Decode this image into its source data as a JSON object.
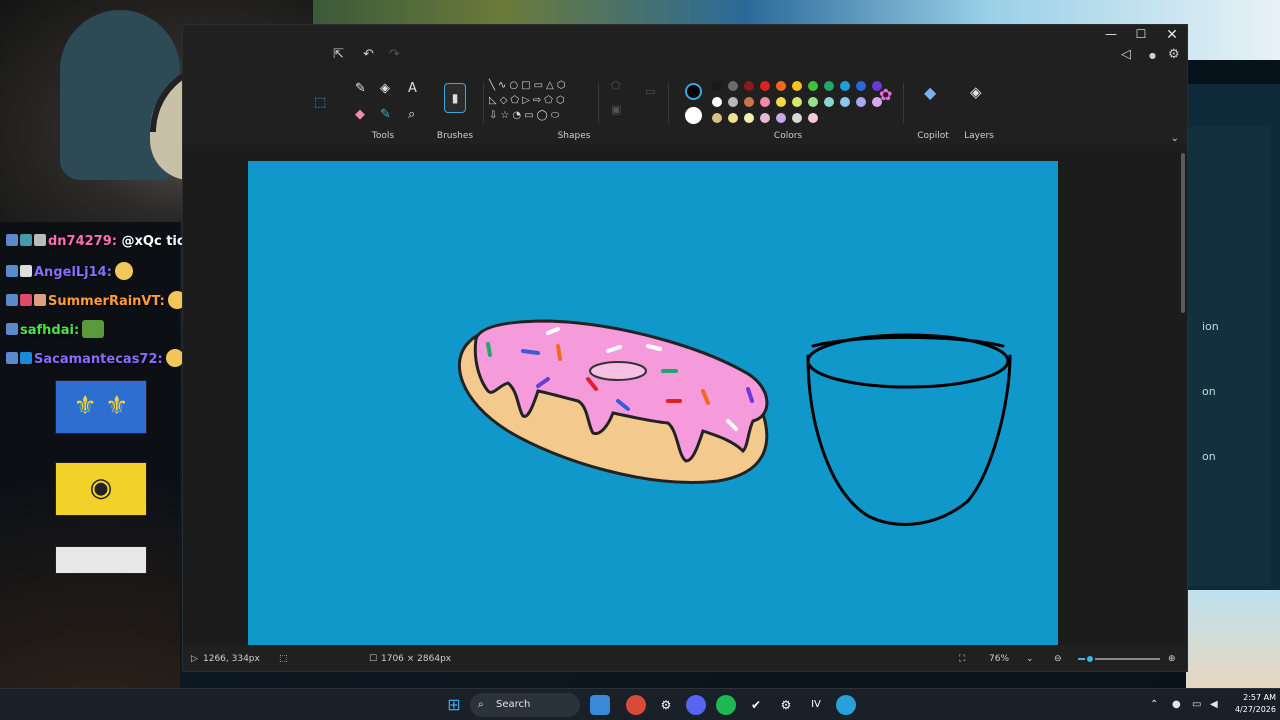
{
  "chat": {
    "messages": [
      {
        "user": "dn74279:",
        "text": "@xQc tickle him pls",
        "color": "#ff6fb5"
      },
      {
        "user": "AngelLj14:",
        "text": "",
        "color": "#8a6cff"
      },
      {
        "user": "SummerRainVT:",
        "text": "",
        "color": "#ff9b3a"
      },
      {
        "user": "safhdai:",
        "text": "",
        "color": "#4ce04c"
      },
      {
        "user": "Sacamantecas72:",
        "text": "",
        "color": "#8a6cff"
      }
    ]
  },
  "paint": {
    "ribbon": {
      "tools_label": "Tools",
      "brushes_label": "Brushes",
      "shapes_label": "Shapes",
      "colors_label": "Colors",
      "copilot_label": "Copilot",
      "layers_label": "Layers"
    },
    "colors": {
      "row1": [
        "#1a1a1a",
        "#6b6b6b",
        "#8b1a1a",
        "#e02020",
        "#f36a1a",
        "#f7c21a",
        "#3cc43c",
        "#1fa86a",
        "#1aa0d8",
        "#2a6ad8",
        "#6a3ad8"
      ],
      "row2": [
        "#ffffff",
        "#b8b8b8",
        "#c87848",
        "#f48aa8",
        "#f8d84a",
        "#d8e86a",
        "#9ae08a",
        "#8ad8d0",
        "#8ac8f0",
        "#a8a8f0",
        "#d8a8f0"
      ],
      "row3": [
        "#d8c088",
        "#f0e088",
        "#f0f0b0",
        "#e8b8d0",
        "#c8a8e8",
        "#d8d8d8",
        "#f8c8d8"
      ],
      "selected_primary": "#000000",
      "selected_secondary": "#ffffff",
      "canvas_bg": "#0f98c9"
    },
    "status": {
      "cursor": "1266, 334px",
      "canvas_size": "1706 × 2864px",
      "zoom": "76%"
    }
  },
  "desktop": {
    "side_labels": [
      "ion",
      "on",
      "on"
    ]
  },
  "taskbar": {
    "search_label": "Search",
    "time": "2:57 AM",
    "date": "4/27/2026"
  }
}
